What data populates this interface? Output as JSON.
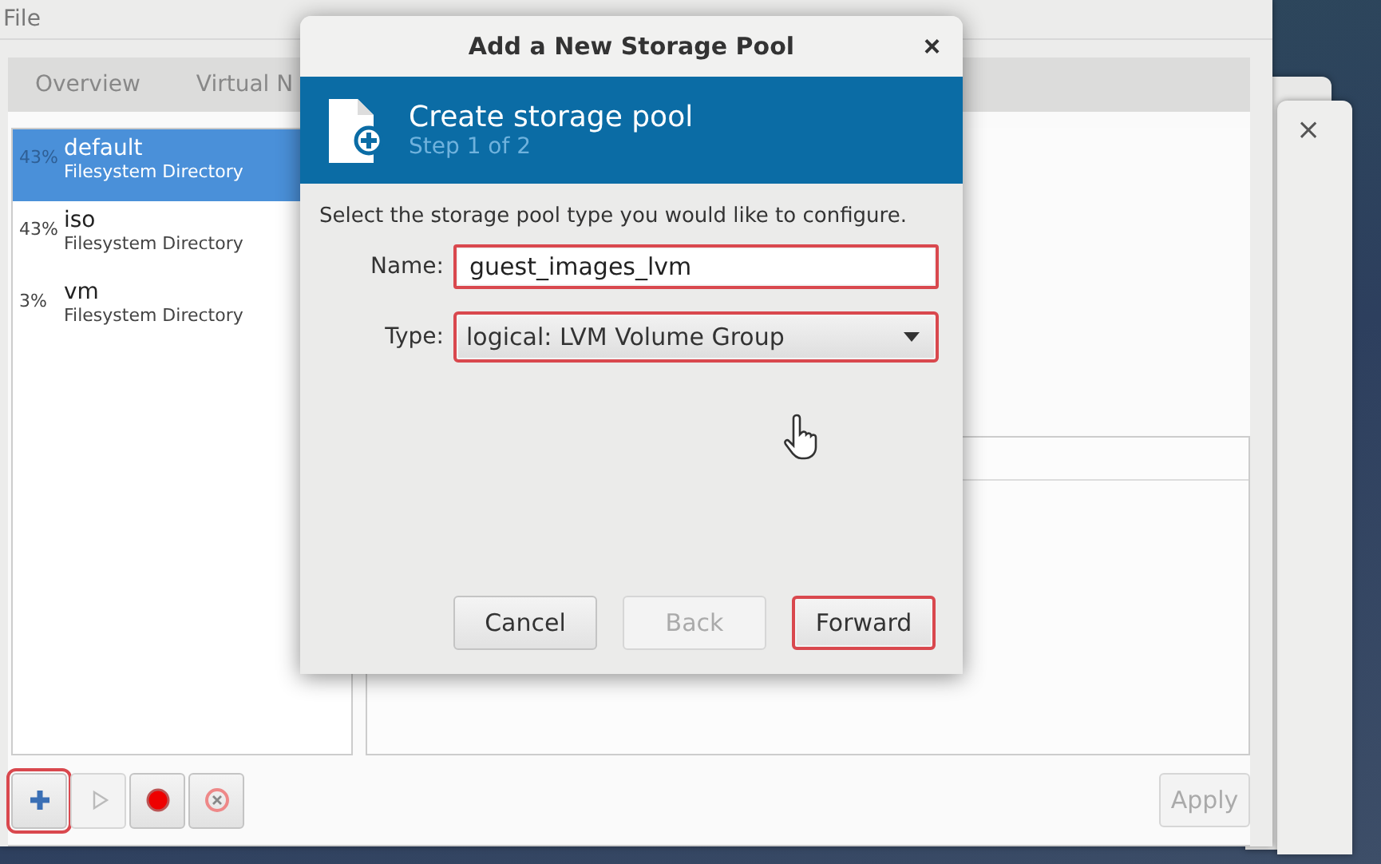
{
  "main_window": {
    "menu": [
      "File"
    ],
    "tabs": [
      {
        "label": "Overview",
        "selected": false
      },
      {
        "label": "Virtual N",
        "selected": false
      }
    ],
    "pools": [
      {
        "usage": "43%",
        "name": "default",
        "type": "Filesystem Directory",
        "selected": true
      },
      {
        "usage": "43%",
        "name": "iso",
        "type": "Filesystem Directory",
        "selected": false
      },
      {
        "usage": "3%",
        "name": "vm",
        "type": "Filesystem Directory",
        "selected": false
      }
    ],
    "toolbar": [
      {
        "kind": "add",
        "disabled": false,
        "highlighted": true
      },
      {
        "kind": "start",
        "disabled": true,
        "highlighted": false
      },
      {
        "kind": "stop",
        "disabled": false,
        "highlighted": false
      },
      {
        "kind": "delete",
        "disabled": false,
        "highlighted": false
      }
    ],
    "apply_button": {
      "label": "Apply",
      "disabled": true
    }
  },
  "background_windows": [
    {
      "close": "×"
    }
  ],
  "dialog": {
    "title": "Add a New Storage Pool",
    "close": "×",
    "header": {
      "title": "Create storage pool",
      "step": "Step 1 of 2"
    },
    "instruction": "Select the storage pool type you would like to configure.",
    "fields": [
      {
        "kind": "text",
        "label": "Name:",
        "value": "guest_images_lvm",
        "highlighted": true
      },
      {
        "kind": "combo",
        "label": "Type:",
        "value": "logical: LVM Volume Group",
        "highlighted": true
      }
    ],
    "buttons": [
      {
        "label": "Cancel",
        "disabled": false,
        "highlighted": false
      },
      {
        "label": "Back",
        "disabled": true,
        "highlighted": false
      },
      {
        "label": "Forward",
        "disabled": false,
        "highlighted": true
      }
    ]
  }
}
